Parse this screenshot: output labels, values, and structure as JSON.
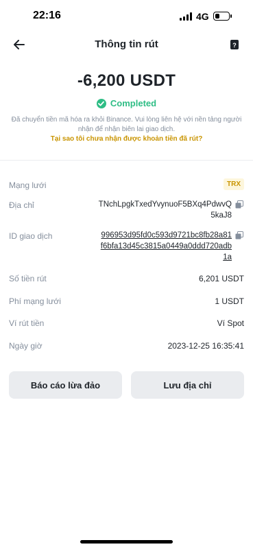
{
  "status_bar": {
    "time": "22:16",
    "network": "4G"
  },
  "header": {
    "title": "Thông tin rút"
  },
  "amount": "-6,200 USDT",
  "status": {
    "text": "Completed",
    "color": "#2ebd85"
  },
  "description": "Đã chuyển tiền mã hóa ra khỏi Binance. Vui lòng liên hệ với nền tảng người nhận để nhận biên lai giao dịch.",
  "help_link": "Tại sao tôi chưa nhận được khoản tiền đã rút?",
  "details": {
    "network": {
      "label": "Mạng lưới",
      "value": "TRX"
    },
    "address": {
      "label": "Địa chỉ",
      "line1": "TNchLpgkTxedYvynuoF5BXq4PdwvQ",
      "line2": "5kaJ8"
    },
    "txid": {
      "label": "ID giao dịch",
      "line1": "996953d95fd0c593d9721bc8fb28a81",
      "line2": "f6bfa13d45c3815a0449a0ddd720adb",
      "line3": "1a"
    },
    "amount": {
      "label": "Số tiền rút",
      "value": "6,201 USDT"
    },
    "fee": {
      "label": "Phí mạng lưới",
      "value": "1 USDT"
    },
    "wallet": {
      "label": "Ví rút tiền",
      "value": "Ví Spot"
    },
    "datetime": {
      "label": "Ngày giờ",
      "value": "2023-12-25 16:35:41"
    }
  },
  "buttons": {
    "report": "Báo cáo lừa đảo",
    "save_address": "Lưu địa chỉ"
  },
  "colors": {
    "accent": "#c99400",
    "success": "#2ebd85",
    "muted": "#848e9c",
    "button_bg": "#eaecef"
  }
}
